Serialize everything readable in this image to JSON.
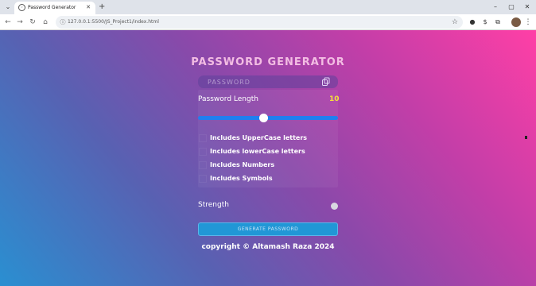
{
  "browser": {
    "tab_title": "Password Generator",
    "url": "127.0.0.1:5500/JS_Project1/index.html"
  },
  "app": {
    "heading": "PASSWORD GENERATOR",
    "password_placeholder": "PASSWORD",
    "length_label": "Password Length",
    "length_value": "10",
    "slider_fraction": 0.47,
    "options": [
      {
        "label": "Includes UpperCase letters",
        "checked": false
      },
      {
        "label": "Includes lowerCase letters",
        "checked": false
      },
      {
        "label": "Includes Numbers",
        "checked": false
      },
      {
        "label": "Includes Symbols",
        "checked": false
      }
    ],
    "strength_label": "Strength",
    "generate_label": "GENERATE PASSWORD",
    "footer": "copyright © Altamash Raza 2024"
  },
  "colors": {
    "length_value": "#f5e13a",
    "slider": "#1f7ff0",
    "button": "#2197d6",
    "gradient_start": "#2a8fd1",
    "gradient_end": "#ff3fa6"
  }
}
